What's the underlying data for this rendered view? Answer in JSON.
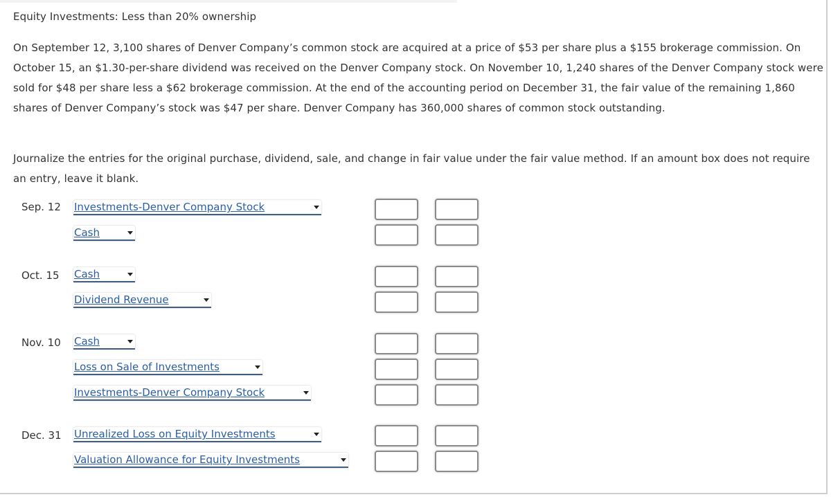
{
  "title": "Equity Investments: Less than 20% ownership",
  "problem_text": "On September 12, 3,100 shares of Denver Company’s common stock are acquired at a price of $53 per share plus a $155 brokerage commission. On October 15, an $1.30-per-share dividend was received on the Denver Company stock. On November 10, 1,240 shares of the Denver Company stock were sold for $48 per share less a $62 brokerage commission. At the end of the accounting period on December 31, the fair value of the remaining 1,860 shares of Denver Company’s stock was $47 per share. Denver Company has 360,000 shares of common stock outstanding.",
  "instructions": "Journalize the entries for the original purchase, dividend, sale, and change in fair value under the fair value method. If an amount box does not require an entry, leave it blank.",
  "colors": {
    "link_blue": "#2b5ea6",
    "select_underline": "#3f5e82",
    "box_border": "#8a8a8a"
  },
  "journal": {
    "entries": [
      {
        "date": "Sep. 12",
        "lines": [
          {
            "account": "Investments-Denver Company Stock",
            "debit": "",
            "credit": ""
          },
          {
            "account": "Cash",
            "debit": "",
            "credit": ""
          }
        ]
      },
      {
        "date": "Oct. 15",
        "lines": [
          {
            "account": "Cash",
            "debit": "",
            "credit": ""
          },
          {
            "account": "Dividend Revenue",
            "debit": "",
            "credit": ""
          }
        ]
      },
      {
        "date": "Nov. 10",
        "lines": [
          {
            "account": "Cash",
            "debit": "",
            "credit": ""
          },
          {
            "account": "Loss on Sale of Investments",
            "debit": "",
            "credit": ""
          },
          {
            "account": "Investments-Denver Company Stock",
            "debit": "",
            "credit": ""
          }
        ]
      },
      {
        "date": "Dec. 31",
        "lines": [
          {
            "account": "Unrealized Loss on Equity Investments",
            "debit": "",
            "credit": ""
          },
          {
            "account": "Valuation Allowance for Equity Investments",
            "debit": "",
            "credit": ""
          }
        ]
      }
    ]
  }
}
